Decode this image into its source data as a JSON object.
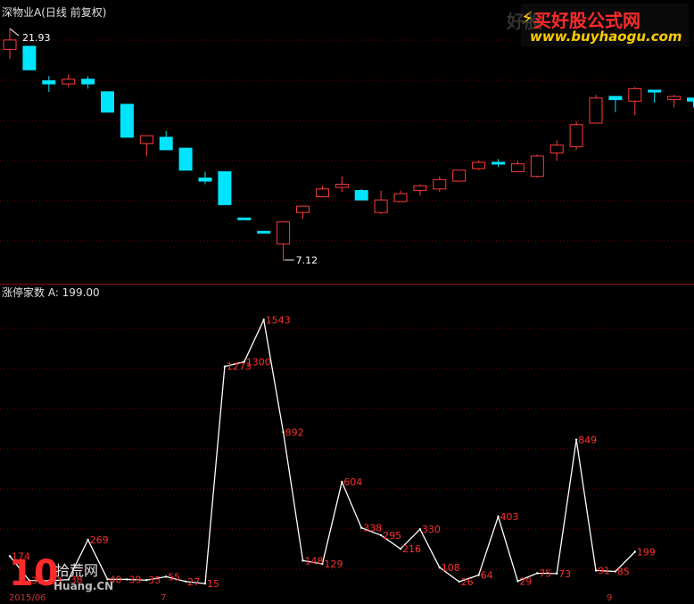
{
  "candle_panel": {
    "title": "深物业A(日线 前复权)",
    "high_label": "21.93",
    "low_label": "7.12"
  },
  "indicator_panel": {
    "title": "涨停家数  A: 199.00"
  },
  "watermark": {
    "ghost": "好股",
    "title": "买好股公式网",
    "url": "www.buyhaogu.com"
  },
  "logo": {
    "number": "10",
    "name": "拾荒网",
    "url": "Huang.CN"
  },
  "x_axis": {
    "start_label": "2015/06",
    "mid_label": "7",
    "end_label": "9"
  },
  "colors": {
    "up": "#ff3b3b",
    "down": "#00e5ff",
    "line": "#ffffff",
    "label": "#ff3030",
    "grid": "#7a0000"
  },
  "chart_data": [
    {
      "type": "candlestick",
      "title": "深物业A(日线 前复权)",
      "ylim": [
        6.0,
        22.5
      ],
      "candles": [
        {
          "o": 20.6,
          "h": 21.93,
          "l": 20.0,
          "c": 21.2,
          "dir": "up"
        },
        {
          "o": 20.8,
          "h": 20.8,
          "l": 19.3,
          "c": 19.3,
          "dir": "down"
        },
        {
          "o": 18.6,
          "h": 18.9,
          "l": 17.9,
          "c": 18.4,
          "dir": "down"
        },
        {
          "o": 18.4,
          "h": 19.0,
          "l": 18.2,
          "c": 18.7,
          "dir": "up"
        },
        {
          "o": 18.7,
          "h": 18.9,
          "l": 18.1,
          "c": 18.4,
          "dir": "down"
        },
        {
          "o": 17.9,
          "h": 17.9,
          "l": 16.6,
          "c": 16.6,
          "dir": "down"
        },
        {
          "o": 17.1,
          "h": 17.1,
          "l": 15.0,
          "c": 15.0,
          "dir": "down"
        },
        {
          "o": 14.6,
          "h": 15.1,
          "l": 13.8,
          "c": 15.1,
          "dir": "up"
        },
        {
          "o": 15.0,
          "h": 15.4,
          "l": 14.2,
          "c": 14.2,
          "dir": "down"
        },
        {
          "o": 14.3,
          "h": 14.3,
          "l": 12.9,
          "c": 12.9,
          "dir": "down"
        },
        {
          "o": 12.4,
          "h": 12.8,
          "l": 12.0,
          "c": 12.2,
          "dir": "down"
        },
        {
          "o": 12.8,
          "h": 12.8,
          "l": 10.7,
          "c": 10.7,
          "dir": "down"
        },
        {
          "o": 9.85,
          "h": 9.85,
          "l": 9.75,
          "c": 9.75,
          "dir": "down"
        },
        {
          "o": 9.0,
          "h": 9.0,
          "l": 9.0,
          "c": 9.0,
          "dir": "down"
        },
        {
          "o": 8.2,
          "h": 9.6,
          "l": 7.12,
          "c": 9.6,
          "dir": "up"
        },
        {
          "o": 10.2,
          "h": 10.3,
          "l": 9.8,
          "c": 10.6,
          "dir": "up"
        },
        {
          "o": 11.2,
          "h": 11.9,
          "l": 11.2,
          "c": 11.7,
          "dir": "up"
        },
        {
          "o": 11.8,
          "h": 12.5,
          "l": 11.5,
          "c": 12.0,
          "dir": "up"
        },
        {
          "o": 11.6,
          "h": 11.7,
          "l": 11.0,
          "c": 11.0,
          "dir": "down"
        },
        {
          "o": 10.2,
          "h": 11.6,
          "l": 10.1,
          "c": 11.0,
          "dir": "up"
        },
        {
          "o": 10.9,
          "h": 11.6,
          "l": 10.9,
          "c": 11.4,
          "dir": "up"
        },
        {
          "o": 11.6,
          "h": 12.0,
          "l": 11.3,
          "c": 11.9,
          "dir": "up"
        },
        {
          "o": 11.7,
          "h": 12.5,
          "l": 11.5,
          "c": 12.3,
          "dir": "up"
        },
        {
          "o": 12.2,
          "h": 12.9,
          "l": 12.2,
          "c": 12.9,
          "dir": "up"
        },
        {
          "o": 13.0,
          "h": 13.5,
          "l": 12.9,
          "c": 13.4,
          "dir": "up"
        },
        {
          "o": 13.4,
          "h": 13.6,
          "l": 13.1,
          "c": 13.4,
          "dir": "down"
        },
        {
          "o": 12.8,
          "h": 13.5,
          "l": 12.8,
          "c": 13.3,
          "dir": "up"
        },
        {
          "o": 12.5,
          "h": 13.9,
          "l": 12.4,
          "c": 13.8,
          "dir": "up"
        },
        {
          "o": 14.0,
          "h": 14.8,
          "l": 13.5,
          "c": 14.5,
          "dir": "up"
        },
        {
          "o": 14.4,
          "h": 16.0,
          "l": 14.2,
          "c": 15.8,
          "dir": "up"
        },
        {
          "o": 15.9,
          "h": 17.7,
          "l": 15.9,
          "c": 17.5,
          "dir": "up"
        },
        {
          "o": 17.6,
          "h": 17.6,
          "l": 16.6,
          "c": 17.4,
          "dir": "down"
        },
        {
          "o": 17.3,
          "h": 18.2,
          "l": 16.4,
          "c": 18.1,
          "dir": "up"
        },
        {
          "o": 18.0,
          "h": 18.0,
          "l": 17.2,
          "c": 18.0,
          "dir": "down"
        },
        {
          "o": 17.4,
          "h": 17.7,
          "l": 16.9,
          "c": 17.6,
          "dir": "up"
        },
        {
          "o": 17.5,
          "h": 17.5,
          "l": 16.9,
          "c": 17.3,
          "dir": "down"
        }
      ]
    },
    {
      "type": "line",
      "title": "涨停家数",
      "ylim": [
        0,
        1680
      ],
      "values": [
        174,
        33,
        31,
        38,
        269,
        40,
        39,
        35,
        55,
        27,
        15,
        1273,
        1300,
        1543,
        892,
        148,
        129,
        604,
        338,
        295,
        216,
        330,
        108,
        26,
        64,
        403,
        29,
        75,
        73,
        849,
        91,
        85,
        199
      ],
      "labels": [
        "174",
        "33",
        "31",
        "38",
        "269",
        "40",
        "39",
        "35",
        "55",
        "27",
        "15",
        "1273",
        "1300",
        "1543",
        "892",
        "148",
        "129",
        "604",
        "338",
        "295",
        "216",
        "330",
        "108",
        "26",
        "64",
        "403",
        "29",
        "75",
        "73",
        "849",
        "91",
        "85",
        "199"
      ]
    }
  ]
}
